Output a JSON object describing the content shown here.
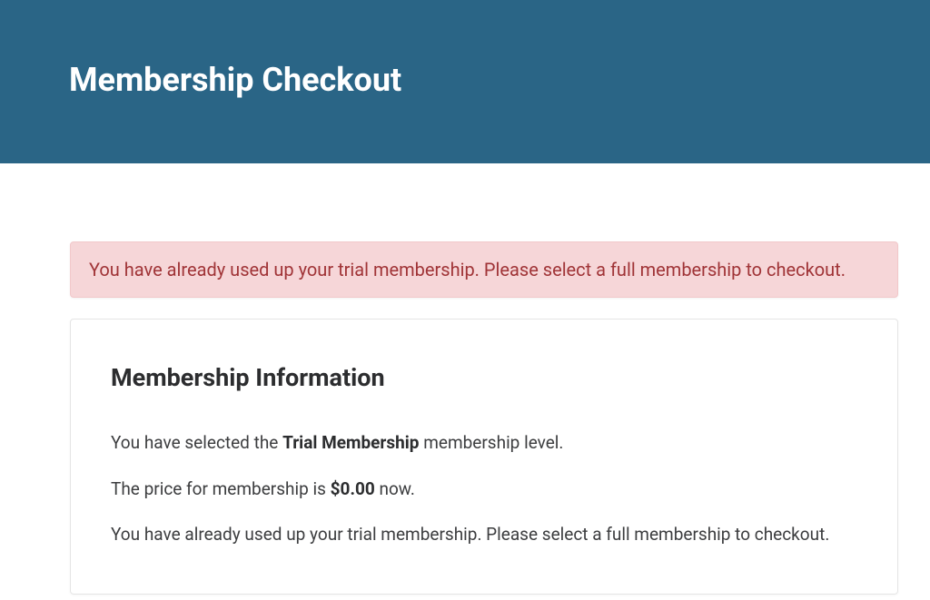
{
  "header": {
    "title": "Membership Checkout"
  },
  "alert": {
    "message": "You have already used up your trial membership. Please select a full membership to checkout."
  },
  "card": {
    "heading": "Membership Information",
    "line1_prefix": "You have selected the ",
    "line1_bold": "Trial Membership",
    "line1_suffix": " membership level.",
    "line2_prefix": "The price for membership is ",
    "line2_bold": "$0.00",
    "line2_suffix": " now.",
    "line3": "You have already used up your trial membership. Please select a full membership to checkout."
  }
}
